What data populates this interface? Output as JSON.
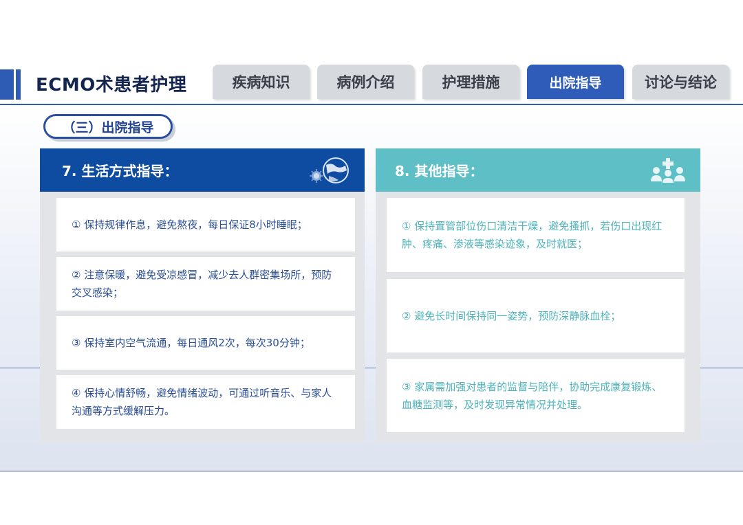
{
  "header": {
    "title": "ECMO术患者护理",
    "tabs": [
      {
        "label": "疾病知识",
        "active": false
      },
      {
        "label": "病例介绍",
        "active": false
      },
      {
        "label": "护理措施",
        "active": false
      },
      {
        "label": "出院指导",
        "active": true
      },
      {
        "label": "讨论与结论",
        "active": false
      }
    ]
  },
  "section": {
    "label": "（三）出院指导"
  },
  "left_panel": {
    "title": "7. 生活方式指导：",
    "icon": "globe-virus-icon",
    "items": [
      "① 保持规律作息，避免熬夜，每日保证8小时睡眠；",
      "② 注意保暖，避免受凉感冒，减少去人群密集场所，预防交叉感染；",
      "③ 保持室内空气流通，每日通风2次，每次30分钟；",
      "④ 保持心情舒畅，避免情绪波动，可通过听音乐、与家人沟通等方式缓解压力。"
    ]
  },
  "right_panel": {
    "title": "8. 其他指导：",
    "icon": "medical-team-icon",
    "items": [
      "① 保持置管部位伤口清洁干燥，避免搔抓，若伤口出现红肿、疼痛、渗液等感染迹象，及时就医；",
      "② 避免长时间保持同一姿势，预防深静脉血栓；",
      "③ 家属需加强对患者的监督与陪伴，协助完成康复锻炼、血糖监测等，及时发现异常情况并处理。"
    ]
  },
  "colors": {
    "primary": "#2e5cb8",
    "left_header": "#0e4ca1",
    "right_header": "#5ec0c6",
    "left_text": "#2a4e96",
    "right_text": "#4db3ba"
  }
}
